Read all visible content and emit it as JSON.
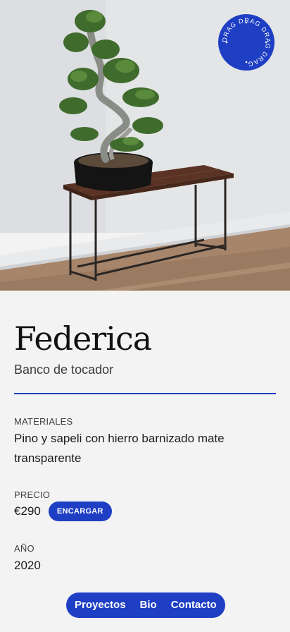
{
  "product": {
    "title": "Federica",
    "subtitle": "Banco de tocador"
  },
  "badge": {
    "text": "DRAG DRAG DRAG DRAG"
  },
  "specs": {
    "materials_label": "MATERIALES",
    "materials_value": "Pino y sapeli con hierro barnizado mate transparente",
    "price_label": "PRECIO",
    "price_value": "€290",
    "order_label": "ENCARGAR",
    "year_label": "AÑO",
    "year_value": "2020"
  },
  "nav": {
    "items": [
      {
        "label": "Proyectos"
      },
      {
        "label": "Bio"
      },
      {
        "label": "Contacto"
      }
    ]
  },
  "colors": {
    "accent": "#1e3fc4",
    "background": "#f3f3f3"
  }
}
